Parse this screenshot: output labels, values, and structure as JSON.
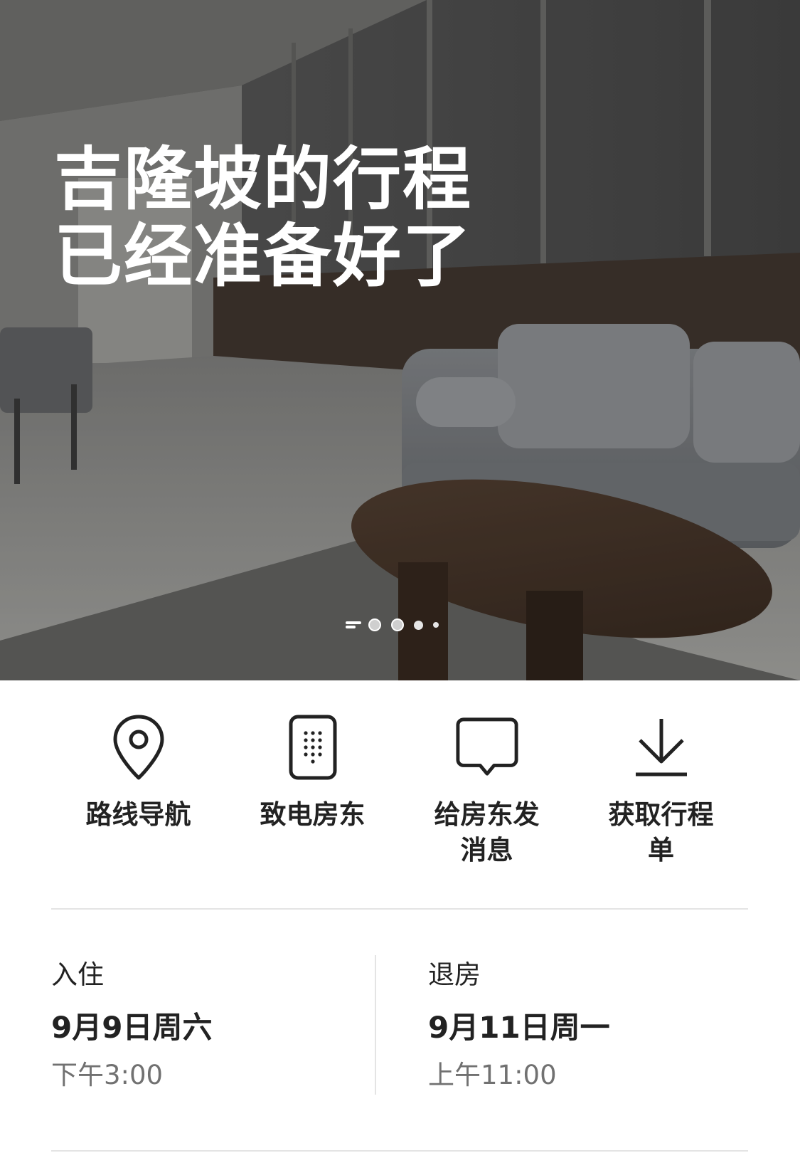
{
  "hero": {
    "title_line1": "吉隆坡的行程",
    "title_line2": "已经准备好了",
    "carousel": {
      "count": 5,
      "active_index": 0
    }
  },
  "actions": [
    {
      "icon": "location-pin-icon",
      "label": "路线导航"
    },
    {
      "icon": "phone-keypad-icon",
      "label": "致电房东"
    },
    {
      "icon": "message-bubble-icon",
      "label": "给房东发消息"
    },
    {
      "icon": "download-icon",
      "label": "获取行程单"
    }
  ],
  "stay": {
    "checkin": {
      "label": "入住",
      "date": "9月9日周六",
      "time": "下午3:00"
    },
    "checkout": {
      "label": "退房",
      "date": "9月11日周一",
      "time": "上午11:00"
    }
  },
  "colors": {
    "text_primary": "#222222",
    "text_secondary": "#717171",
    "divider": "#e4e4e4",
    "hero_title": "#ffffff"
  }
}
